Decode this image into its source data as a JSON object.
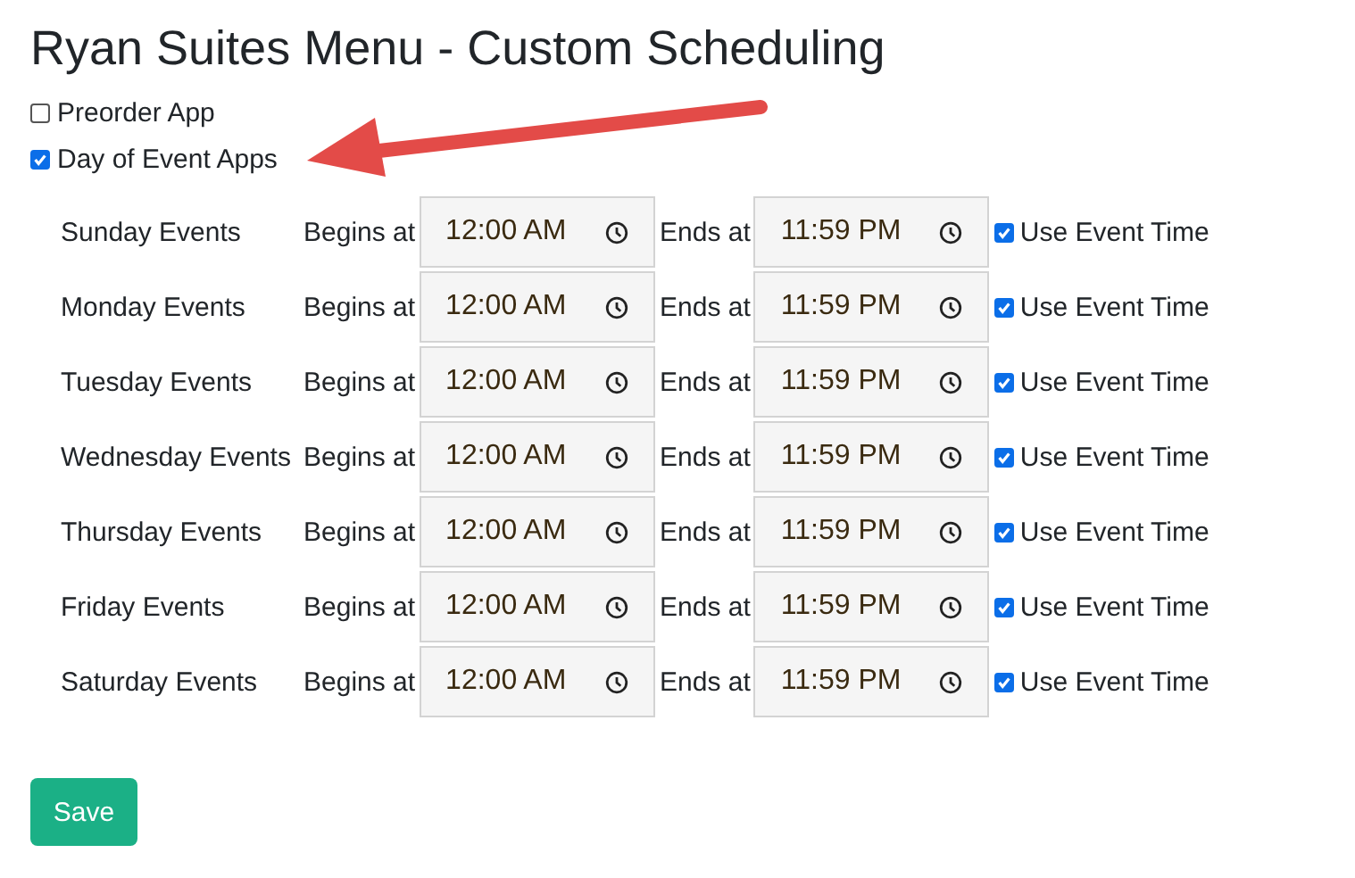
{
  "title": "Ryan Suites Menu - Custom Scheduling",
  "apps": [
    {
      "label": "Preorder App",
      "checked": false
    },
    {
      "label": "Day of Event Apps",
      "checked": true
    }
  ],
  "days": [
    {
      "name": "Sunday Events",
      "begins_label": "Begins at",
      "begins": "12:00 AM",
      "ends_label": "Ends at",
      "ends": "11:59 PM",
      "use_event_time": "Use Event Time",
      "checked": true
    },
    {
      "name": "Monday Events",
      "begins_label": "Begins at",
      "begins": "12:00 AM",
      "ends_label": "Ends at",
      "ends": "11:59 PM",
      "use_event_time": "Use Event Time",
      "checked": true
    },
    {
      "name": "Tuesday Events",
      "begins_label": "Begins at",
      "begins": "12:00 AM",
      "ends_label": "Ends at",
      "ends": "11:59 PM",
      "use_event_time": "Use Event Time",
      "checked": true
    },
    {
      "name": "Wednesday Events",
      "begins_label": "Begins at",
      "begins": "12:00 AM",
      "ends_label": "Ends at",
      "ends": "11:59 PM",
      "use_event_time": "Use Event Time",
      "checked": true
    },
    {
      "name": "Thursday Events",
      "begins_label": "Begins at",
      "begins": "12:00 AM",
      "ends_label": "Ends at",
      "ends": "11:59 PM",
      "use_event_time": "Use Event Time",
      "checked": true
    },
    {
      "name": "Friday Events",
      "begins_label": "Begins at",
      "begins": "12:00 AM",
      "ends_label": "Ends at",
      "ends": "11:59 PM",
      "use_event_time": "Use Event Time",
      "checked": true
    },
    {
      "name": "Saturday Events",
      "begins_label": "Begins at",
      "begins": "12:00 AM",
      "ends_label": "Ends at",
      "ends": "11:59 PM",
      "use_event_time": "Use Event Time",
      "checked": true
    }
  ],
  "save_button": "Save"
}
